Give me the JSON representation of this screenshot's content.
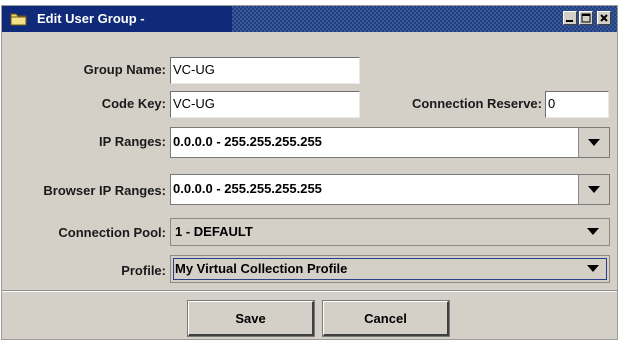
{
  "window": {
    "title": "Edit User Group -",
    "controls": [
      "minimize",
      "maximize",
      "close"
    ]
  },
  "form": {
    "group_name": {
      "label": "Group Name:",
      "value": "VC-UG"
    },
    "code_key": {
      "label": "Code Key:",
      "value": "VC-UG"
    },
    "connection_reserve": {
      "label": "Connection Reserve:",
      "value": "0"
    },
    "ip_ranges": {
      "label": "IP Ranges:",
      "value": "0.0.0.0 - 255.255.255.255"
    },
    "browser_ip_ranges": {
      "label": "Browser IP Ranges:",
      "value": "0.0.0.0 - 255.255.255.255"
    },
    "connection_pool": {
      "label": "Connection Pool:",
      "value": "1 - DEFAULT"
    },
    "profile": {
      "label": "Profile:",
      "value": "My Virtual Collection Profile"
    }
  },
  "buttons": {
    "save": "Save",
    "cancel": "Cancel"
  },
  "colors": {
    "titlebar": "#0f2a78",
    "window_bg": "#d4d0c8",
    "field_bg": "#ffffff",
    "focus_border": "#2a3f8a"
  }
}
